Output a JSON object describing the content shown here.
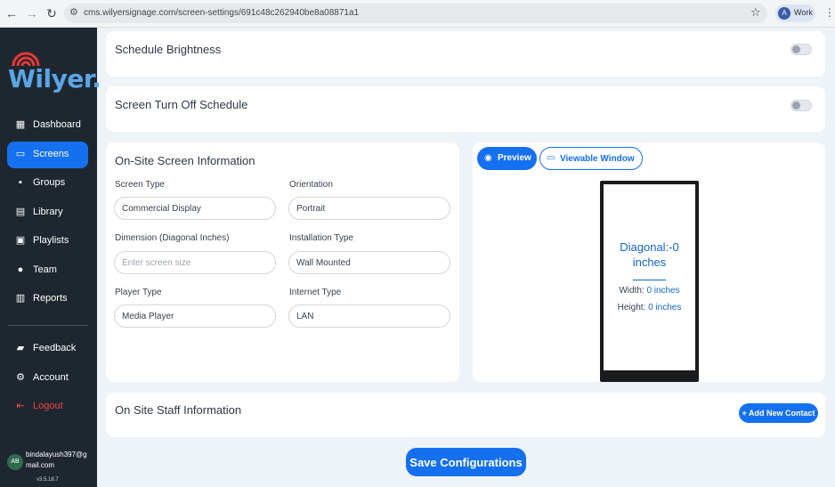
{
  "browser": {
    "url": "cms.wilyersignage.com/screen-settings/691c48c262940be8a08871a1",
    "profile_label": "Work",
    "profile_initial": "A"
  },
  "sidebar": {
    "logo_text": "Wilyer.",
    "items": [
      {
        "label": "Dashboard",
        "icon": "dashboard-icon"
      },
      {
        "label": "Screens",
        "icon": "monitor-icon",
        "active": true
      },
      {
        "label": "Groups",
        "icon": "grid-icon"
      },
      {
        "label": "Library",
        "icon": "film-icon"
      },
      {
        "label": "Playlists",
        "icon": "playlist-icon"
      },
      {
        "label": "Team",
        "icon": "team-icon"
      },
      {
        "label": "Reports",
        "icon": "clipboard-icon"
      }
    ],
    "bottom_items": [
      {
        "label": "Feedback",
        "icon": "feedback-icon"
      },
      {
        "label": "Account",
        "icon": "gear-icon"
      },
      {
        "label": "Logout",
        "icon": "logout-icon"
      }
    ],
    "user": {
      "initials": "AB",
      "email": "bindalayush397@gmail.com"
    },
    "version": "v3.5.18.7"
  },
  "schedule_brightness": {
    "title": "Schedule Brightness",
    "enabled": false
  },
  "screen_turn_off": {
    "title": "Screen Turn Off Schedule",
    "enabled": false
  },
  "onsite_info": {
    "title": "On-Site Screen Information",
    "fields": {
      "screen_type": {
        "label": "Screen Type",
        "value": "Commercial Display"
      },
      "orientation": {
        "label": "Orientation",
        "value": "Portrait"
      },
      "dimension": {
        "label": "Dimension (Diagonal Inches)",
        "value": "",
        "placeholder": "Enter screen size"
      },
      "installation_type": {
        "label": "Installation Type",
        "value": "Wall Mounted"
      },
      "player_type": {
        "label": "Player Type",
        "value": "Media Player"
      },
      "internet_type": {
        "label": "Internet Type",
        "value": "LAN"
      }
    }
  },
  "preview": {
    "preview_label": "Preview",
    "viewable_window_label": "Viewable Window",
    "diagonal_text": "Diagonal:-0 inches",
    "width_label": "Width:",
    "width_value": "0 inches",
    "height_label": "Height:",
    "height_value": "0 inches"
  },
  "staff": {
    "title": "On Site Staff Information",
    "add_contact_label": "+ Add New Contact"
  },
  "save_label": "Save Configurations"
}
